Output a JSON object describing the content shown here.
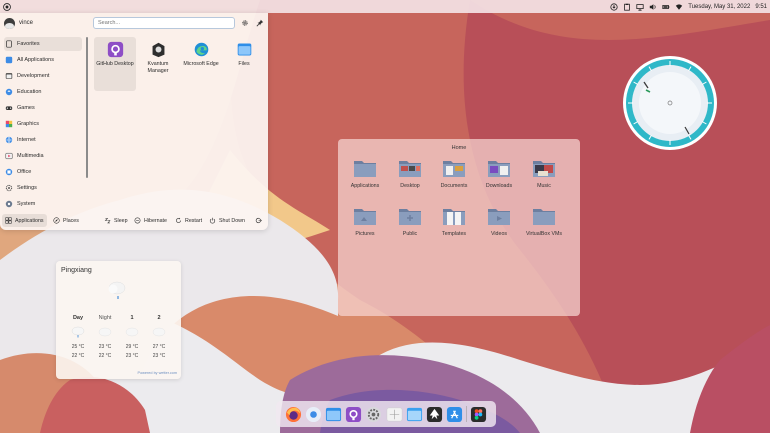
{
  "topbar": {
    "date": "Tuesday, May 31, 2022",
    "time": "9:51"
  },
  "launcher": {
    "username": "vince",
    "search_placeholder": "Search...",
    "categories": [
      {
        "label": "Favorites",
        "icon": "star-icon"
      },
      {
        "label": "All Applications",
        "icon": "grid-icon"
      },
      {
        "label": "Development",
        "icon": "development-icon"
      },
      {
        "label": "Education",
        "icon": "education-icon"
      },
      {
        "label": "Games",
        "icon": "gamepad-icon"
      },
      {
        "label": "Graphics",
        "icon": "graphics-icon"
      },
      {
        "label": "Internet",
        "icon": "globe-icon"
      },
      {
        "label": "Multimedia",
        "icon": "multimedia-icon"
      },
      {
        "label": "Office",
        "icon": "office-icon"
      },
      {
        "label": "Settings",
        "icon": "gear-icon"
      },
      {
        "label": "System",
        "icon": "system-icon"
      }
    ],
    "apps": [
      {
        "label": "GitHub Desktop",
        "icon": "github-desktop-icon"
      },
      {
        "label": "Kvantum Manager",
        "icon": "kvantum-icon"
      },
      {
        "label": "Microsoft Edge",
        "icon": "edge-icon"
      },
      {
        "label": "Files",
        "icon": "folder-icon"
      }
    ],
    "footer": {
      "applications": "Applications",
      "places": "Places",
      "sleep": "Sleep",
      "hibernate": "Hibernate",
      "restart": "Restart",
      "shutdown": "Shut Down"
    }
  },
  "weather": {
    "location": "Pingxiang",
    "columns": [
      {
        "label": "Day",
        "high": "25 °C",
        "low": "22 °C"
      },
      {
        "label": "Night",
        "high": "23 °C",
        "low": "22 °C"
      },
      {
        "label": "1",
        "high": "29 °C",
        "low": "23 °C"
      },
      {
        "label": "2",
        "high": "27 °C",
        "low": "23 °C"
      }
    ],
    "powered_by": "Powered by wetter.com"
  },
  "folder": {
    "title": "Home",
    "items": [
      "Applications",
      "Desktop",
      "Documents",
      "Downloads",
      "Music",
      "Pictures",
      "Public",
      "Templates",
      "Videos",
      "VirtualBox VMs"
    ]
  },
  "colors": {
    "accent": "#2fb8c8",
    "folder_blue": "#7c8fb0"
  }
}
